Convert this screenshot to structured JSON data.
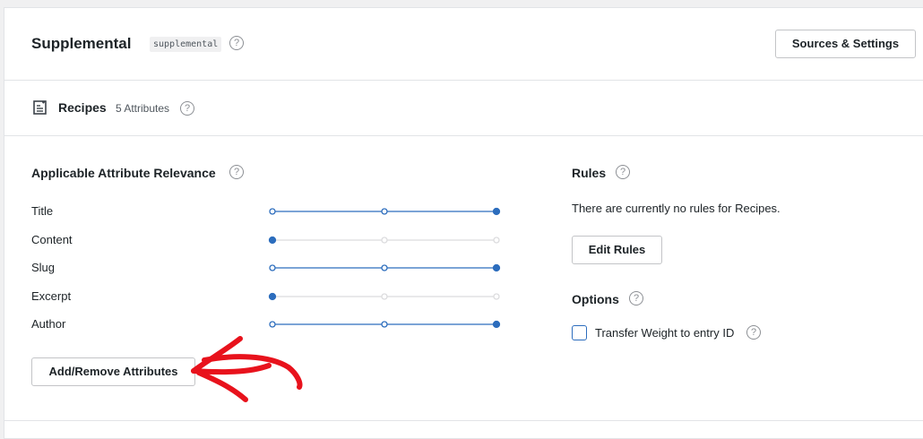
{
  "engine": {
    "title": "Supplemental",
    "slug": "supplemental",
    "sources_button": "Sources & Settings"
  },
  "source": {
    "name": "Recipes",
    "count": "5 Attributes"
  },
  "relevance": {
    "heading": "Applicable Attribute Relevance",
    "attributes": [
      {
        "label": "Title",
        "level": 3
      },
      {
        "label": "Content",
        "level": 1
      },
      {
        "label": "Slug",
        "level": 3
      },
      {
        "label": "Excerpt",
        "level": 1
      },
      {
        "label": "Author",
        "level": 3
      }
    ],
    "max_level": 3,
    "add_remove_button": "Add/Remove Attributes"
  },
  "rules": {
    "heading": "Rules",
    "empty_text": "There are currently no rules for Recipes.",
    "edit_button": "Edit Rules"
  },
  "options": {
    "heading": "Options",
    "transfer_label": "Transfer Weight to entry ID",
    "transfer_checked": false
  },
  "help_glyph": "?",
  "colors": {
    "accent": "#2c6dbd",
    "arrow": "#e8121c",
    "inactive_track": "#dcdcde"
  }
}
